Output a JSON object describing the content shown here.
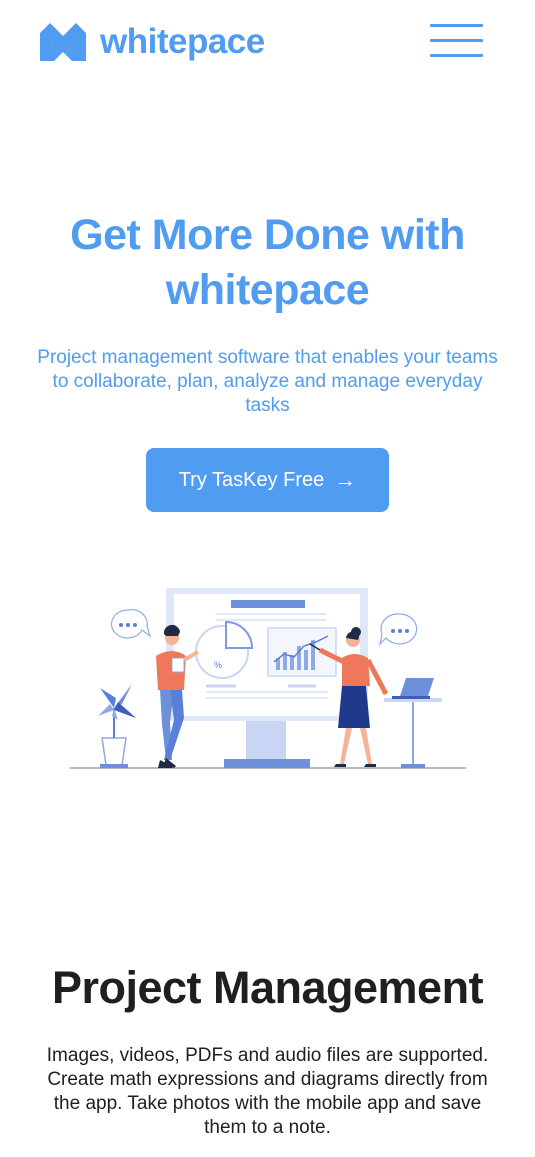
{
  "header": {
    "logo_text": "whitepace",
    "brand_color": "#4f9cf0",
    "menu_icon": "hamburger-menu-icon"
  },
  "hero": {
    "title": "Get More Done with whitepace",
    "subtitle": "Project management software that enables your teams to collaborate, plan, analyze and manage everyday tasks",
    "cta_label": "Try TasKey Free",
    "cta_arrow": "→",
    "illustration_chart_symbol": "%"
  },
  "section": {
    "title": "Project Management",
    "text": "Images, videos, PDFs and audio files are supported. Create math expressions and diagrams directly from the app. Take photos with the mobile app and save them to a note."
  },
  "colors": {
    "accent": "#4f9cf0",
    "heading_dark": "#1f1f22",
    "illustration_blue": "#5b7fd8",
    "illustration_orange": "#f0785a"
  }
}
